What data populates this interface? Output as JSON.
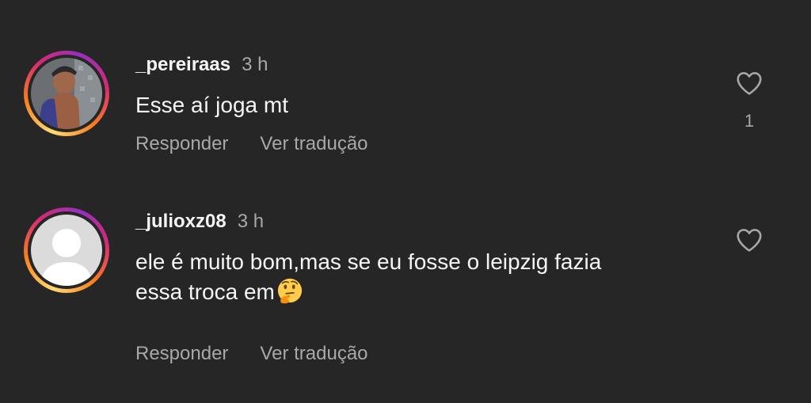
{
  "comments": [
    {
      "username": "_pereiraas",
      "time": "3 h",
      "text": "Esse aí joga mt",
      "reply_label": "Responder",
      "translate_label": "Ver tradução",
      "like_count": "1",
      "avatar": "user-photo"
    },
    {
      "username": "_julioxz08",
      "time": "3 h",
      "text_line1": "ele é muito bom,mas se eu fosse o leipzig fazia",
      "text_line2": "essa troca em",
      "emoji": "thinking-face",
      "reply_label": "Responder",
      "translate_label": "Ver tradução",
      "avatar": "default-avatar"
    }
  ],
  "colors": {
    "background": "#262626",
    "primary_text": "#f5f5f5",
    "secondary_text": "#a8a8a8"
  }
}
